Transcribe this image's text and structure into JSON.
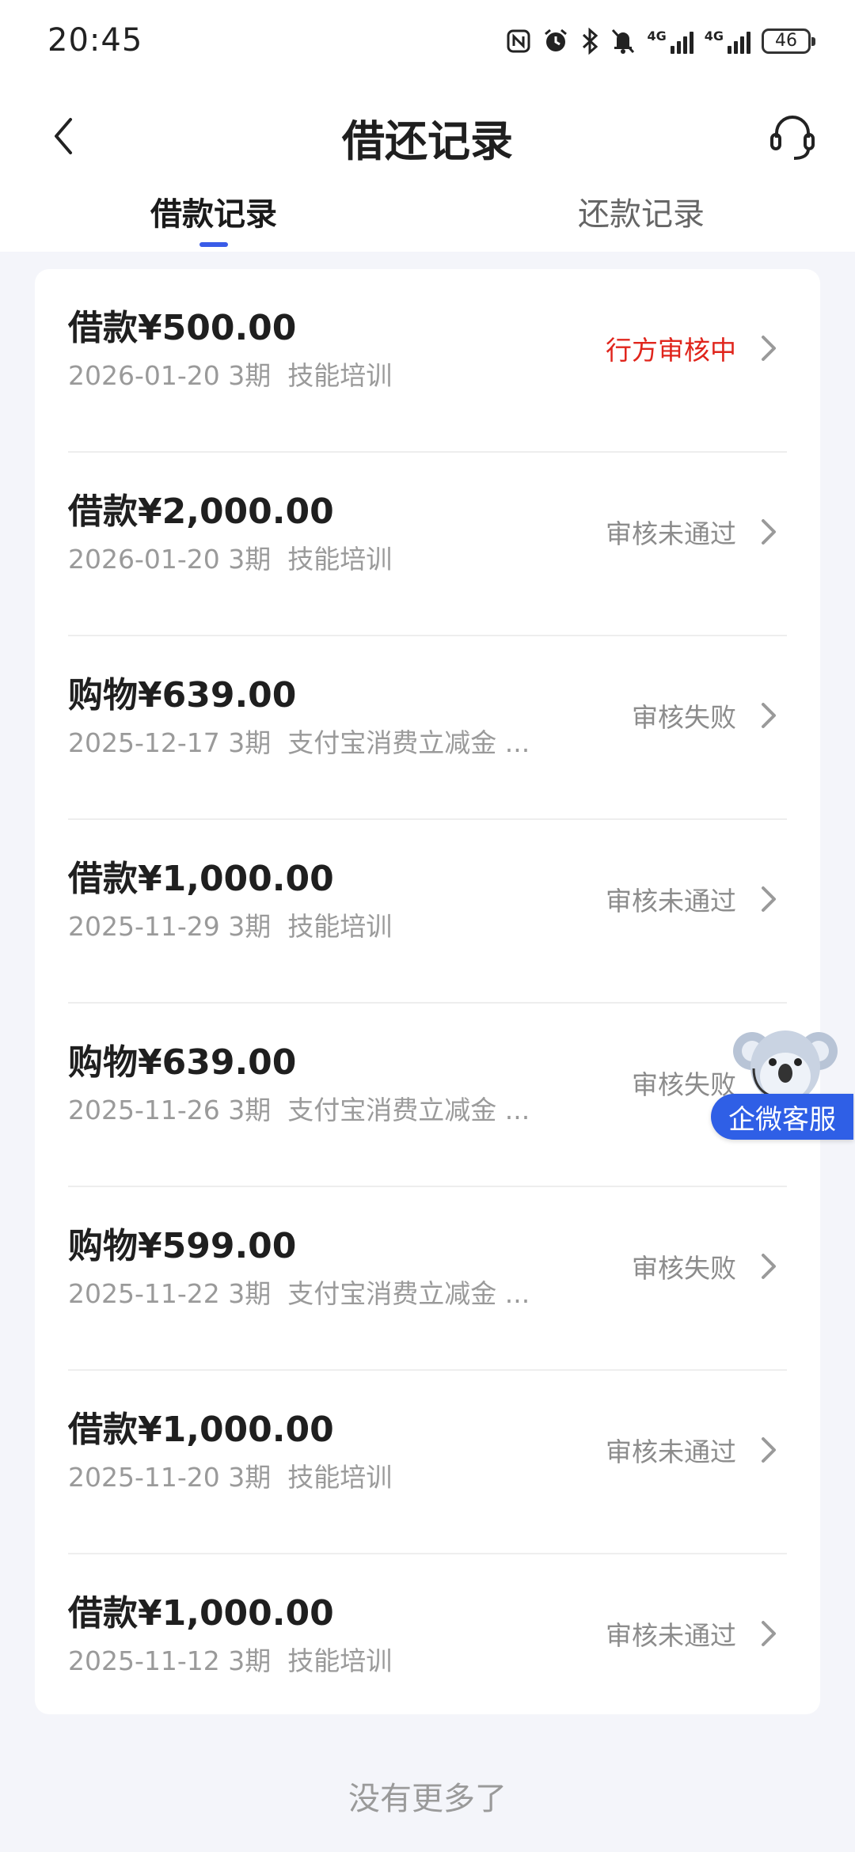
{
  "status_bar": {
    "time": "20:45",
    "icons": [
      "nfc-icon",
      "alarm-icon",
      "bluetooth-icon",
      "mute-icon",
      "signal-4g-icon",
      "signal-4g-icon"
    ],
    "signal_label_1": "4G",
    "signal_label_2": "4G",
    "battery": "46"
  },
  "header": {
    "title": "借还记录",
    "back_icon": "chevron-left-icon",
    "service_icon": "headset-icon"
  },
  "tabs": [
    {
      "label": "借款记录",
      "active": true
    },
    {
      "label": "还款记录",
      "active": false
    }
  ],
  "records": [
    {
      "amount": "借款¥500.00",
      "date": "2026-01-20",
      "term": "3期",
      "purpose": "技能培训",
      "status": "行方审核中",
      "pending": true
    },
    {
      "amount": "借款¥2,000.00",
      "date": "2026-01-20",
      "term": "3期",
      "purpose": "技能培训",
      "status": "审核未通过",
      "pending": false
    },
    {
      "amount": "购物¥639.00",
      "date": "2025-12-17",
      "term": "3期",
      "purpose": "支付宝消费立减金 ...",
      "status": "审核失败",
      "pending": false
    },
    {
      "amount": "借款¥1,000.00",
      "date": "2025-11-29",
      "term": "3期",
      "purpose": "技能培训",
      "status": "审核未通过",
      "pending": false
    },
    {
      "amount": "购物¥639.00",
      "date": "2025-11-26",
      "term": "3期",
      "purpose": "支付宝消费立减金 ...",
      "status": "审核失败",
      "pending": false
    },
    {
      "amount": "购物¥599.00",
      "date": "2025-11-22",
      "term": "3期",
      "purpose": "支付宝消费立减金 ...",
      "status": "审核失败",
      "pending": false
    },
    {
      "amount": "借款¥1,000.00",
      "date": "2025-11-20",
      "term": "3期",
      "purpose": "技能培训",
      "status": "审核未通过",
      "pending": false
    },
    {
      "amount": "借款¥1,000.00",
      "date": "2025-11-12",
      "term": "3期",
      "purpose": "技能培训",
      "status": "审核未通过",
      "pending": false
    }
  ],
  "footer": {
    "no_more": "没有更多了"
  },
  "floating_service": {
    "label": "企微客服",
    "icon": "koala-mascot-icon"
  },
  "colors": {
    "accent": "#3a5ce8",
    "pending_status": "#e0251c",
    "muted_status": "#8c8c8c",
    "float_button": "#2f5fe6"
  }
}
